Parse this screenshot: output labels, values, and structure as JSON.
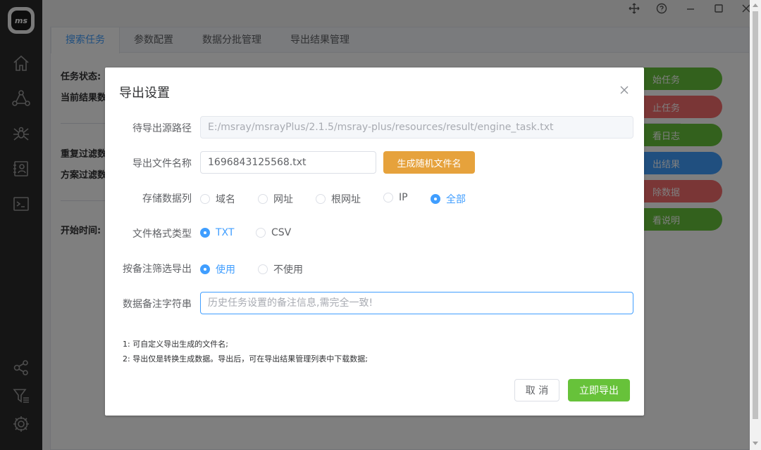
{
  "app": {
    "logo_text": "ms",
    "colors": {
      "primary": "#409eff",
      "success": "#67c23a",
      "warning": "#e6a23c",
      "danger": "#f56c6c"
    }
  },
  "sidebar": {
    "top_icons": [
      "home-icon",
      "network-icon",
      "spider-icon",
      "contacts-icon",
      "terminal-icon"
    ],
    "bottom_icons": [
      "share-icon",
      "filter-list-icon",
      "settings-icon"
    ]
  },
  "tabs": [
    {
      "label": "搜索任务",
      "active": true
    },
    {
      "label": "参数配置",
      "active": false
    },
    {
      "label": "数据分批管理",
      "active": false
    },
    {
      "label": "导出结果管理",
      "active": false
    }
  ],
  "background": {
    "labels": {
      "task_status": "任务状态:",
      "current_results": "当前结果数",
      "dup_filter": "重复过滤数",
      "scheme_filter": "方案过滤数",
      "start_time": "开始时间:"
    },
    "buttons": {
      "start": "始任务",
      "stop": "止任务",
      "log": "看日志",
      "export": "出结果",
      "delete": "除数据",
      "help": "看说明"
    }
  },
  "dialog": {
    "title": "导出设置",
    "source_path": {
      "label": "待导出源路径",
      "value": "E:/msray/msrayPlus/2.1.5/msray-plus/resources/result/engine_task.txt"
    },
    "file_name": {
      "label": "导出文件名称",
      "value": "1696843125568.txt",
      "generate_button": "生成随机文件名"
    },
    "columns": {
      "label": "存储数据列",
      "options": [
        "域名",
        "网址",
        "根网址",
        "IP",
        "全部"
      ],
      "selected": "全部"
    },
    "format": {
      "label": "文件格式类型",
      "options": [
        "TXT",
        "CSV"
      ],
      "selected": "TXT"
    },
    "remark_filter": {
      "label": "按备注筛选导出",
      "options": [
        "使用",
        "不使用"
      ],
      "selected": "使用"
    },
    "remark_string": {
      "label": "数据备注字符串",
      "placeholder": "历史任务设置的备注信息,需完全一致!"
    },
    "notes": [
      "1: 可自定义导出生成的文件名;",
      "2: 导出仅是转换生成数据。导出后，可在导出结果管理列表中下载数据;"
    ],
    "cancel_button": "取 消",
    "export_button": "立即导出"
  }
}
